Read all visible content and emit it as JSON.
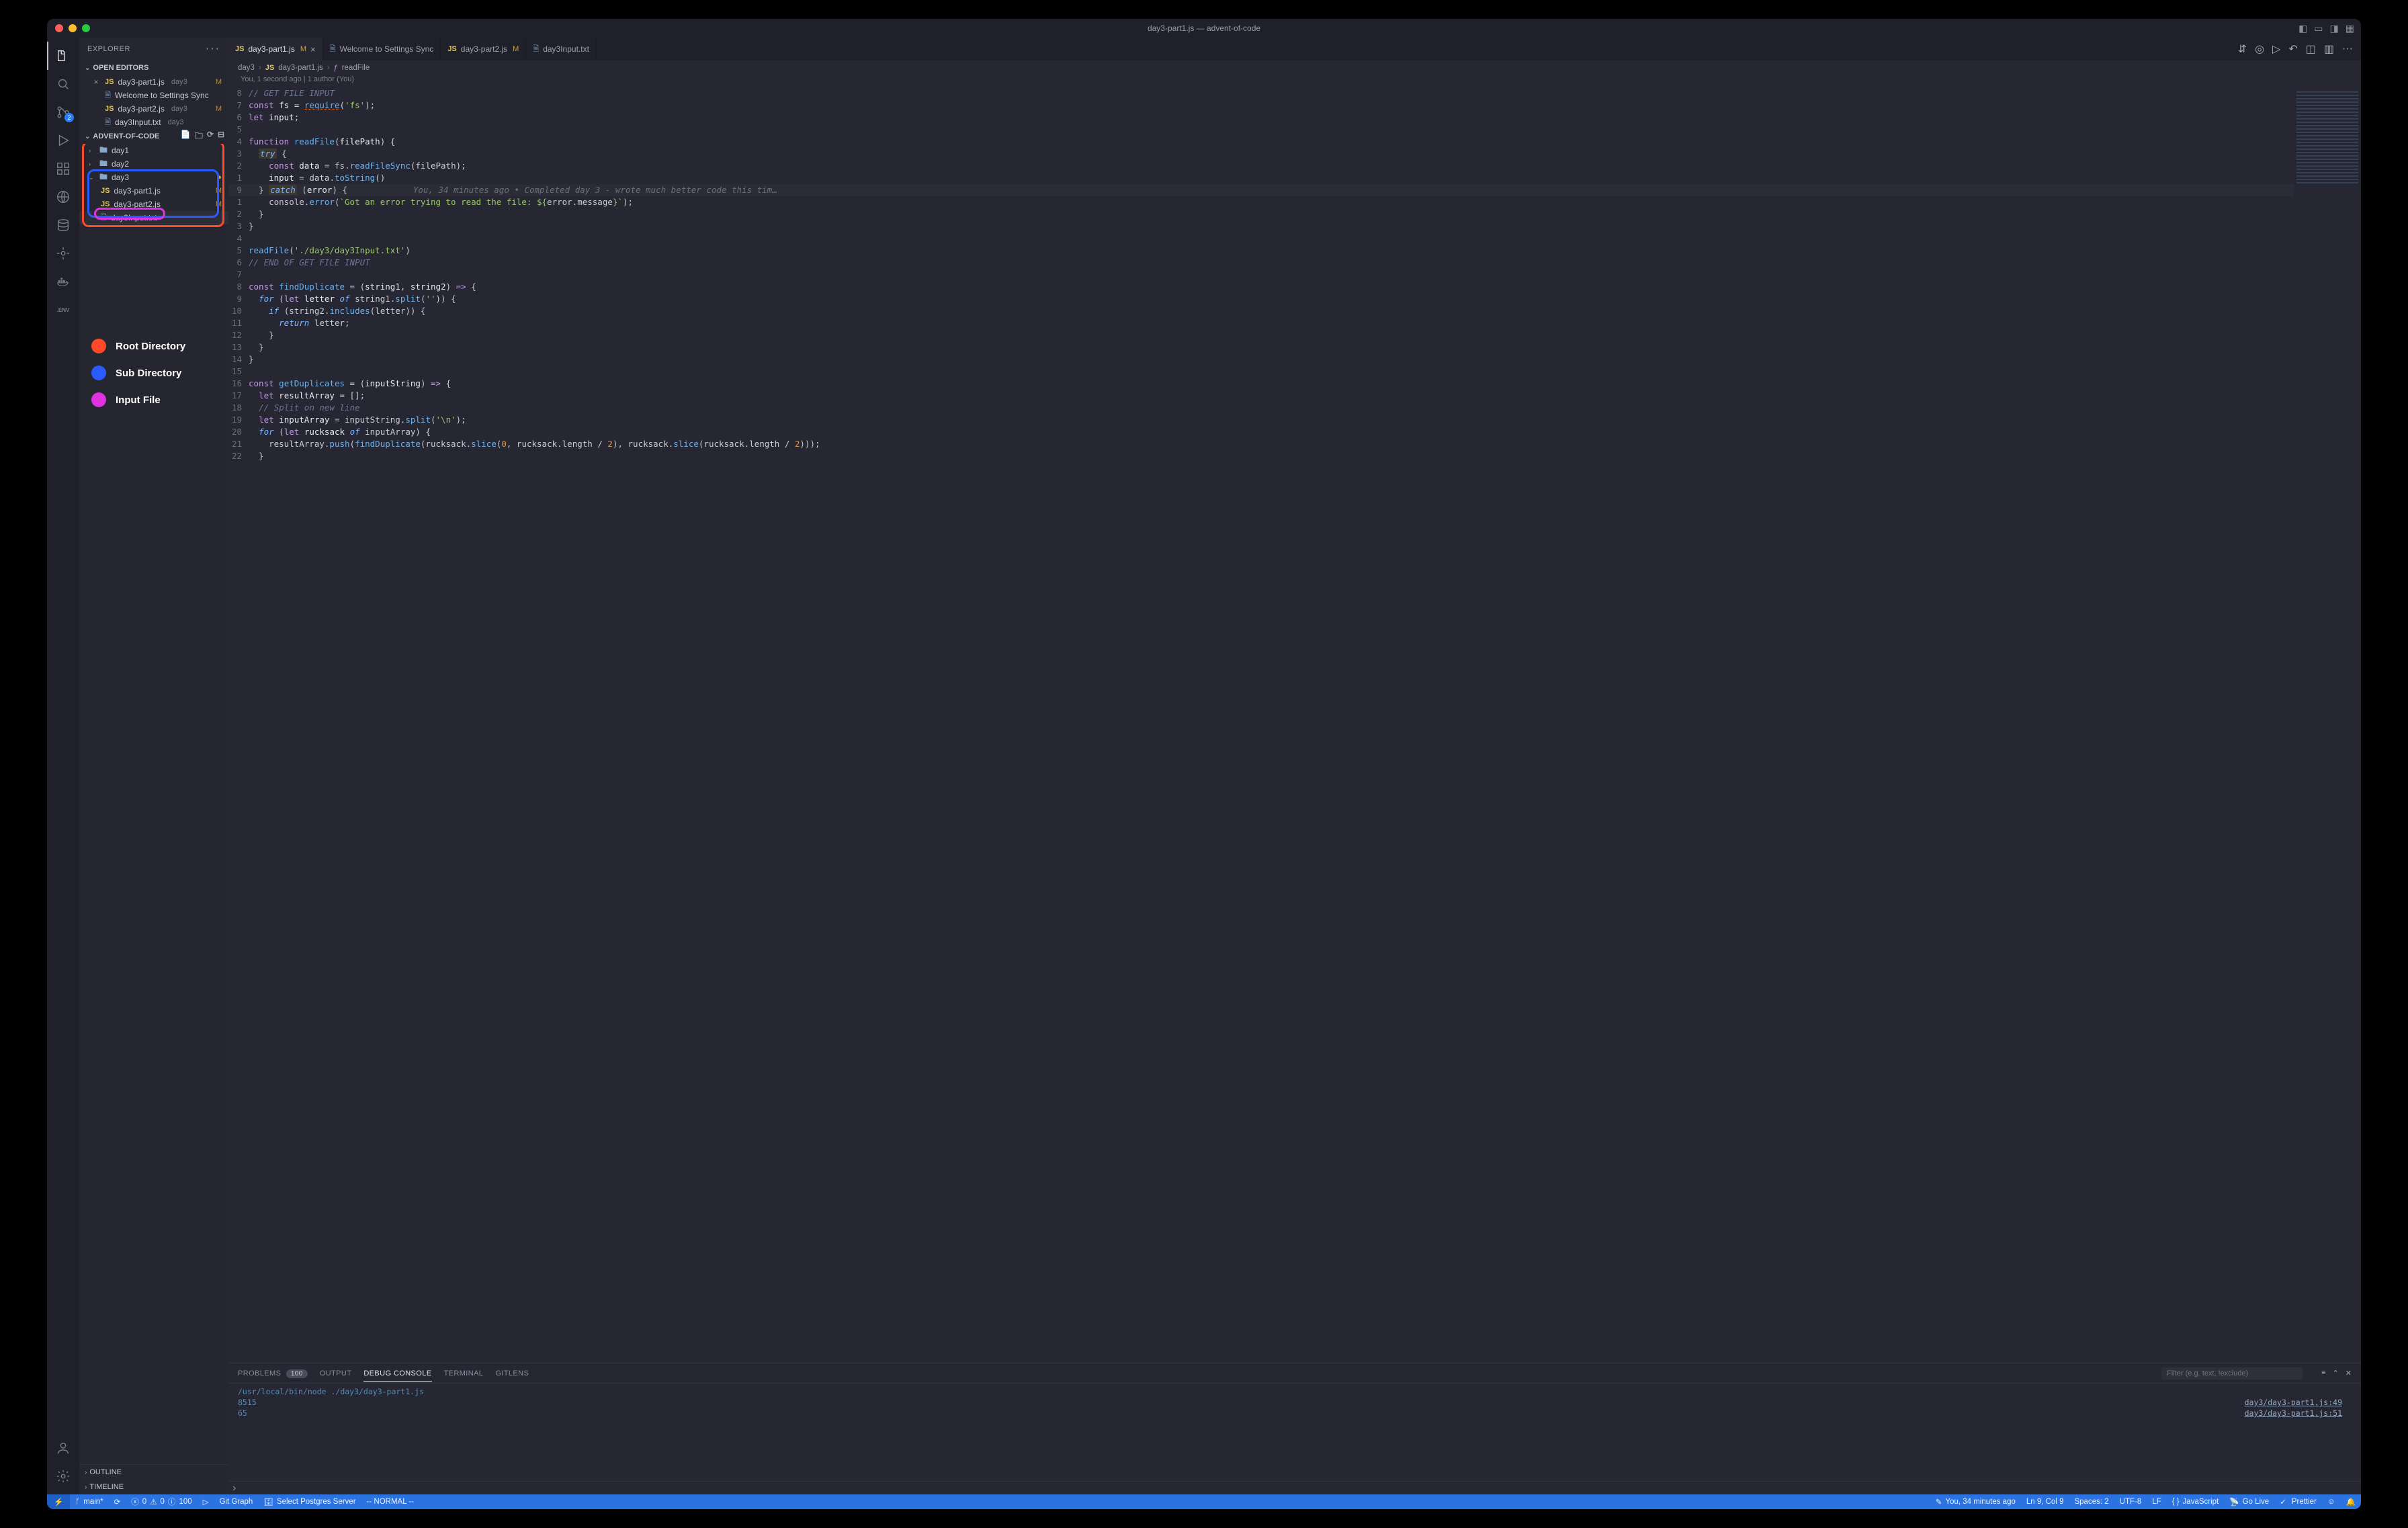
{
  "window": {
    "title": "day3-part1.js — advent-of-code"
  },
  "sidebar": {
    "title": "EXPLORER",
    "openEditorsLabel": "OPEN EDITORS",
    "projectLabel": "ADVENT-OF-CODE",
    "openEditors": [
      {
        "name": "day3-part1.js",
        "path": "day3",
        "status": "M",
        "icon": "js",
        "active": true
      },
      {
        "name": "Welcome to Settings Sync",
        "path": "",
        "status": "",
        "icon": "generic",
        "active": false
      },
      {
        "name": "day3-part2.js",
        "path": "day3",
        "status": "M",
        "icon": "js",
        "active": false
      },
      {
        "name": "day3Input.txt",
        "path": "day3",
        "status": "",
        "icon": "generic",
        "active": false
      }
    ],
    "tree": [
      {
        "type": "folder",
        "name": "day1",
        "open": false,
        "depth": 1
      },
      {
        "type": "folder",
        "name": "day2",
        "open": false,
        "depth": 1
      },
      {
        "type": "folder",
        "name": "day3",
        "open": true,
        "depth": 1,
        "dot": true
      },
      {
        "type": "file",
        "name": "day3-part1.js",
        "icon": "js",
        "status": "M",
        "depth": 2,
        "selected": false
      },
      {
        "type": "file",
        "name": "day3-part2.js",
        "icon": "js",
        "status": "M",
        "depth": 2,
        "selected": false
      },
      {
        "type": "file",
        "name": "day3Input.txt",
        "icon": "generic",
        "status": "",
        "depth": 2,
        "selected": true
      }
    ],
    "outlineLabel": "OUTLINE",
    "timelineLabel": "TIMELINE",
    "scmBadge": "2"
  },
  "legend": {
    "root": "Root Directory",
    "sub": "Sub Directory",
    "file": "Input File"
  },
  "tabs": [
    {
      "name": "day3-part1.js",
      "icon": "js",
      "status": "M",
      "active": true,
      "close": true
    },
    {
      "name": "Welcome to Settings Sync",
      "icon": "generic",
      "status": "",
      "active": false,
      "close": false
    },
    {
      "name": "day3-part2.js",
      "icon": "js",
      "status": "M",
      "active": false,
      "close": false
    },
    {
      "name": "day3Input.txt",
      "icon": "generic",
      "status": "",
      "active": false,
      "close": false
    }
  ],
  "breadcrumb": {
    "parts": [
      "day3",
      "day3-part1.js",
      "readFile"
    ]
  },
  "gitlensHeader": "You, 1 second ago | 1 author (You)",
  "code": {
    "inlineBlame": "You, 34 minutes ago • Completed day 3 - wrote much better code this tim…",
    "lines": [
      {
        "n": "",
        "rel": "8",
        "html": "<span class='c-com'>// GET FILE INPUT</span>"
      },
      {
        "n": "",
        "rel": "7",
        "html": "<span class='c-kw'>const</span> <span class='c-var'>fs</span> <span class='c-op'>=</span> <span class='c-fn c-err'>require</span>(<span class='c-str'>'fs'</span>);"
      },
      {
        "n": "",
        "rel": "6",
        "html": "<span class='c-kw'>let</span> <span class='c-var'>input</span>;"
      },
      {
        "n": "",
        "rel": "5",
        "html": ""
      },
      {
        "n": "",
        "rel": "4",
        "html": "<span class='c-kw'>function</span> <span class='c-fn'>readFile</span>(<span class='c-var'>filePath</span>) {"
      },
      {
        "n": "",
        "rel": "3",
        "html": "  <span class='hl-box c-kw2'>try</span> {"
      },
      {
        "n": "",
        "rel": "2",
        "html": "    <span class='c-kw'>const</span> <span class='c-var'>data</span> <span class='c-op'>=</span> fs.<span class='c-fn'>readFileSync</span>(filePath);"
      },
      {
        "n": "",
        "rel": "1",
        "html": "    <span class='c-var'>input</span> <span class='c-op'>=</span> data.<span class='c-fn'>toString</span>()"
      },
      {
        "n": "9",
        "rel": "",
        "html": "  } <span class='hl-box c-kw2'>catch</span> (<span class='c-var'>error</span>) {       <span class='codelens-inline'></span>",
        "current": true
      },
      {
        "n": "",
        "rel": "1",
        "html": "    console.<span class='c-fn'>error</span>(<span class='c-str'>`Got an error trying to read the file: ${</span>error.message<span class='c-str'>}`</span>);"
      },
      {
        "n": "",
        "rel": "2",
        "html": "  }"
      },
      {
        "n": "",
        "rel": "3",
        "html": "}"
      },
      {
        "n": "",
        "rel": "4",
        "html": ""
      },
      {
        "n": "",
        "rel": "5",
        "html": "<span class='c-fn'>readFile</span>(<span class='c-str'>'./day3/day3Input.txt'</span>)"
      },
      {
        "n": "",
        "rel": "6",
        "html": "<span class='c-com'>// END OF GET FILE INPUT</span>"
      },
      {
        "n": "",
        "rel": "7",
        "html": ""
      },
      {
        "n": "",
        "rel": "8",
        "html": "<span class='c-kw'>const</span> <span class='c-fn'>findDuplicate</span> <span class='c-op'>=</span> (<span class='c-var'>string1</span>, <span class='c-var'>string2</span>) <span class='c-kw'>=&gt;</span> {"
      },
      {
        "n": "",
        "rel": "9",
        "html": "  <span class='c-kw2'>for</span> (<span class='c-kw'>let</span> <span class='c-var'>letter</span> <span class='c-kw2'>of</span> string1.<span class='c-fn'>split</span>(<span class='c-str'>''</span>)) {"
      },
      {
        "n": "",
        "rel": "10",
        "html": "    <span class='c-kw2'>if</span> (string2.<span class='c-fn'>includes</span>(letter)) {"
      },
      {
        "n": "",
        "rel": "11",
        "html": "      <span class='c-kw2'>return</span> letter;"
      },
      {
        "n": "",
        "rel": "12",
        "html": "    }"
      },
      {
        "n": "",
        "rel": "13",
        "html": "  }"
      },
      {
        "n": "",
        "rel": "14",
        "html": "}"
      },
      {
        "n": "",
        "rel": "15",
        "html": ""
      },
      {
        "n": "",
        "rel": "16",
        "html": "<span class='c-kw'>const</span> <span class='c-fn'>getDuplicates</span> <span class='c-op'>=</span> (<span class='c-var'>inputString</span>) <span class='c-kw'>=&gt;</span> {"
      },
      {
        "n": "",
        "rel": "17",
        "html": "  <span class='c-kw'>let</span> <span class='c-var'>resultArray</span> <span class='c-op'>=</span> [];"
      },
      {
        "n": "",
        "rel": "18",
        "html": "  <span class='c-com'>// Split on new line</span>"
      },
      {
        "n": "",
        "rel": "19",
        "html": "  <span class='c-kw'>let</span> <span class='c-var'>inputArray</span> <span class='c-op'>=</span> inputString.<span class='c-fn'>split</span>(<span class='c-str'>'\\n'</span>);"
      },
      {
        "n": "",
        "rel": "20",
        "html": "  <span class='c-kw2'>for</span> (<span class='c-kw'>let</span> <span class='c-var'>rucksack</span> <span class='c-kw2'>of</span> inputArray) {"
      },
      {
        "n": "",
        "rel": "21",
        "html": "    resultArray.<span class='c-fn'>push</span>(<span class='c-fn'>findDuplicate</span>(rucksack.<span class='c-fn'>slice</span>(<span class='c-num'>0</span>, rucksack.length <span class='c-op'>/</span> <span class='c-num'>2</span>), rucksack.<span class='c-fn'>slice</span>(rucksack.length <span class='c-op'>/</span> <span class='c-num'>2</span>)));"
      },
      {
        "n": "",
        "rel": "22",
        "html": "  }"
      }
    ],
    "absStart": 1,
    "absNumbers": [
      "",
      "",
      "",
      "",
      "",
      "",
      "",
      "",
      "9",
      "",
      "",
      "",
      "",
      "",
      "",
      "",
      "",
      "9",
      "10",
      "11",
      "12",
      "13",
      "14",
      "15",
      "16",
      "17",
      "18",
      "19",
      "20",
      "21",
      "22"
    ],
    "leftAbs": [
      "",
      "",
      "",
      "",
      "",
      "",
      "",
      "",
      "",
      "",
      "",
      "",
      "",
      "",
      "",
      "",
      "8",
      "9",
      "10",
      "11",
      "12",
      "13",
      "14",
      "15",
      "16",
      "17",
      "18",
      "19",
      "20",
      "21",
      "22"
    ]
  },
  "panel": {
    "tabs": {
      "problems": "PROBLEMS",
      "problemsCount": "100",
      "output": "OUTPUT",
      "debug": "DEBUG CONSOLE",
      "terminal": "TERMINAL",
      "gitlens": "GITLENS"
    },
    "filterPlaceholder": "Filter (e.g. text, !exclude)",
    "lines": [
      {
        "left": "/usr/local/bin/node ./day3/day3-part1.js",
        "right": ""
      },
      {
        "left": "8515",
        "right": "day3/day3-part1.js:49"
      },
      {
        "left": "65",
        "right": "day3/day3-part1.js:51"
      }
    ]
  },
  "statusbar": {
    "branch": "main*",
    "sync": "⟳",
    "errors": "0",
    "warnings": "0",
    "info": "100",
    "gitgraph": "Git Graph",
    "postgres": "Select Postgres Server",
    "vimmode": "-- NORMAL --",
    "blame": "You, 34 minutes ago",
    "lncol": "Ln 9, Col 9",
    "spaces": "Spaces: 2",
    "encoding": "UTF-8",
    "eol": "LF",
    "lang": "JavaScript",
    "golive": "Go Live",
    "prettier": "Prettier"
  }
}
